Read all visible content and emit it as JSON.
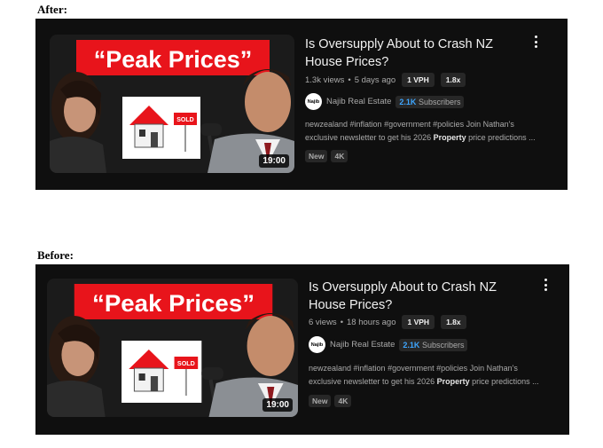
{
  "after": {
    "section_label": "After:",
    "thumbnail": {
      "headline": "“Peak Prices”",
      "sold_sign": "SOLD",
      "duration": "19:00"
    },
    "title_line1": "Is Oversupply About to Crash NZ",
    "title_line2": "House Prices?",
    "views": "1.3k views",
    "separator": "•",
    "age": "5 days ago",
    "pill_vph": "1 VPH",
    "pill_multiplier": "1.8x",
    "channel": {
      "avatar_text": "Najib",
      "name": "Najib Real Estate",
      "subs_count": "2.1K",
      "subs_label": "Subscribers"
    },
    "description_line1": "newzealand #inflation #government #policies Join Nathan's",
    "description_line2_pre": "exclusive newsletter to get his 2026 ",
    "description_line2_bold": "Property",
    "description_line2_post": " price predictions ...",
    "badges": [
      "New",
      "4K"
    ]
  },
  "before": {
    "section_label": "Before:",
    "thumbnail": {
      "headline": "“Peak Prices”",
      "sold_sign": "SOLD",
      "duration": "19:00"
    },
    "title_line1": "Is Oversupply About to Crash NZ",
    "title_line2": "House Prices?",
    "views": "6 views",
    "separator": "•",
    "age": "18 hours ago",
    "pill_vph": "1 VPH",
    "pill_multiplier": "1.8x",
    "channel": {
      "avatar_text": "Najib",
      "name": "Najib Real Estate",
      "subs_count": "2.1K",
      "subs_label": "Subscribers"
    },
    "description_line1": "newzealand #inflation #government #policies Join Nathan's",
    "description_line2_pre": "exclusive newsletter to get his 2026 ",
    "description_line2_bold": "Property",
    "description_line2_post": " price predictions ...",
    "badges": [
      "New",
      "4K"
    ]
  },
  "colors": {
    "card_bg": "#0f0f0f",
    "headline_red": "#e8141b",
    "subs_blue": "#3ea6ff"
  },
  "icons": [
    "more-vert-icon",
    "channel-avatar",
    "house-illustration"
  ]
}
